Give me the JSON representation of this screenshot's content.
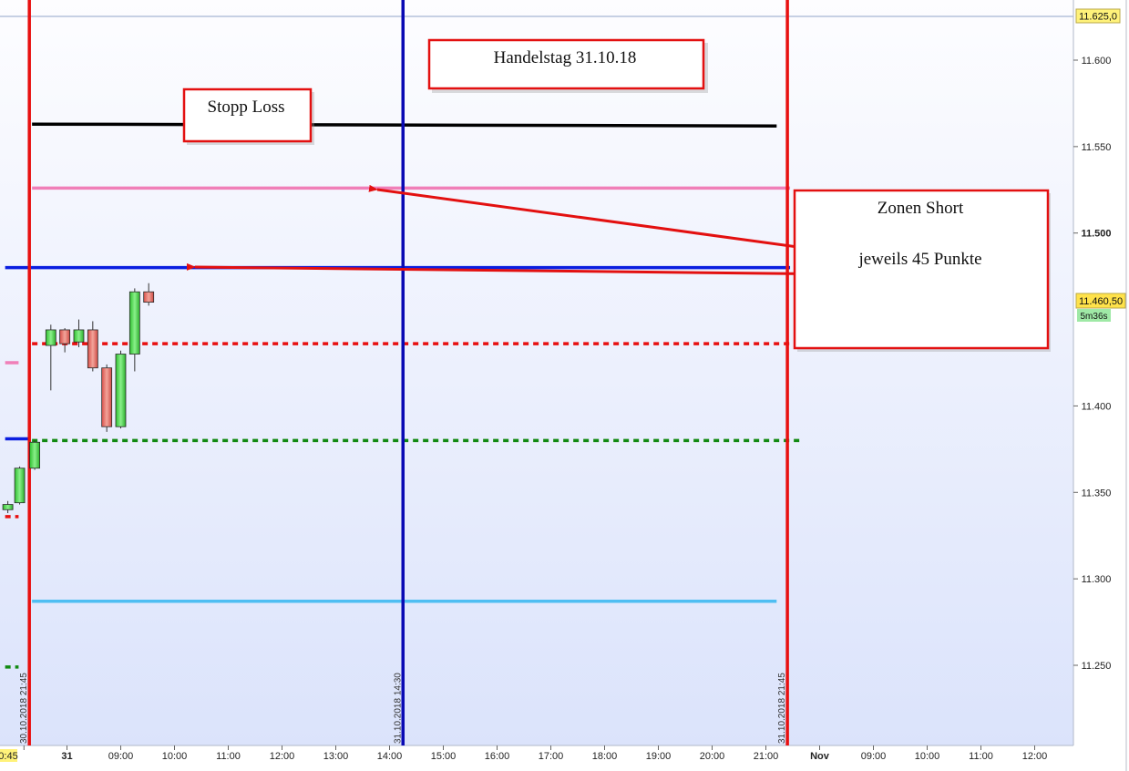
{
  "chart_data": {
    "type": "candlestick",
    "y_axis": {
      "ticks": [
        "11.600",
        "11.550",
        "11.500",
        "11.400",
        "11.350",
        "11.300",
        "11.250"
      ],
      "tick_values": [
        11600,
        11550,
        11500,
        11400,
        11350,
        11300,
        11250
      ],
      "ylim": [
        11204,
        11625
      ],
      "top_label": "11.625,0",
      "last_price_label": "11.460,50",
      "timer_label": "5m36s",
      "last_price": 11460.5
    },
    "x_axis": {
      "ticks": [
        {
          "label": "0:45",
          "t": -0.3
        },
        {
          "label": "31",
          "t": 0.5
        },
        {
          "label": "09:00",
          "t": 1.5
        },
        {
          "label": "10:00",
          "t": 2.5
        },
        {
          "label": "11:00",
          "t": 3.5
        },
        {
          "label": "12:00",
          "t": 4.5
        },
        {
          "label": "13:00",
          "t": 5.5
        },
        {
          "label": "14:00",
          "t": 6.5
        },
        {
          "label": "15:00",
          "t": 7.5
        },
        {
          "label": "16:00",
          "t": 8.5
        },
        {
          "label": "17:00",
          "t": 9.5
        },
        {
          "label": "18:00",
          "t": 10.5
        },
        {
          "label": "19:00",
          "t": 11.5
        },
        {
          "label": "20:00",
          "t": 12.5
        },
        {
          "label": "21:00",
          "t": 13.5
        },
        {
          "label": "Nov",
          "t": 14.5
        },
        {
          "label": "09:00",
          "t": 15.5
        },
        {
          "label": "10:00",
          "t": 16.5
        },
        {
          "label": "11:00",
          "t": 17.5
        },
        {
          "label": "12:00",
          "t": 18.5
        }
      ],
      "tlim": [
        -0.65,
        19.4
      ]
    },
    "vertical_lines": [
      {
        "label": "30.10.2018 21:45",
        "t": -0.2,
        "color": "#e81010"
      },
      {
        "label": "31.10.2018 14:30",
        "t": 6.75,
        "color": "#0a0ab4"
      },
      {
        "label": "31.10.2018 21:45",
        "t": 13.9,
        "color": "#e81010"
      }
    ],
    "horizontal_levels": [
      {
        "y": 11563,
        "t0": -0.15,
        "t1": 13.7,
        "color": "#000000",
        "style": "solid"
      },
      {
        "y": 11526,
        "t0": -0.15,
        "t1": 13.95,
        "color": "#f07fb8",
        "style": "solid"
      },
      {
        "y": 11480,
        "t0": -0.65,
        "t1": 13.95,
        "color": "#0a1ee0",
        "style": "solid"
      },
      {
        "y": 11436,
        "t0": -0.15,
        "t1": 13.95,
        "color": "#e81010",
        "style": "dashed"
      },
      {
        "y": 11380,
        "t0": -0.15,
        "t1": 14.2,
        "color": "#128a12",
        "style": "dashed"
      },
      {
        "y": 11287,
        "t0": -0.15,
        "t1": 13.7,
        "color": "#4fbef2",
        "style": "solid"
      },
      {
        "y": 11425,
        "t0": -0.65,
        "t1": -0.4,
        "color": "#f07fb8",
        "style": "solid"
      },
      {
        "y": 11381,
        "t0": -0.65,
        "t1": -0.2,
        "color": "#0a1ee0",
        "style": "solid"
      },
      {
        "y": 11336,
        "t0": -0.65,
        "t1": -0.4,
        "color": "#e81010",
        "style": "dashed"
      },
      {
        "y": 11249,
        "t0": -0.65,
        "t1": -0.4,
        "color": "#128a12",
        "style": "dashed"
      }
    ],
    "candles": [
      {
        "t": -0.6,
        "o": 11340,
        "h": 11345,
        "l": 11338,
        "c": 11343
      },
      {
        "t": -0.38,
        "o": 11344,
        "h": 11365,
        "l": 11343,
        "c": 11364
      },
      {
        "t": -0.1,
        "o": 11364,
        "h": 11380,
        "l": 11363,
        "c": 11379
      },
      {
        "t": 0.2,
        "o": 11435,
        "h": 11447,
        "l": 11409,
        "c": 11444
      },
      {
        "t": 0.46,
        "o": 11444,
        "h": 11445,
        "l": 11431,
        "c": 11436
      },
      {
        "t": 0.72,
        "o": 11437,
        "h": 11450,
        "l": 11434,
        "c": 11444
      },
      {
        "t": 0.98,
        "o": 11444,
        "h": 11449,
        "l": 11420,
        "c": 11422
      },
      {
        "t": 1.24,
        "o": 11422,
        "h": 11424,
        "l": 11385,
        "c": 11388
      },
      {
        "t": 1.5,
        "o": 11388,
        "h": 11432,
        "l": 11387,
        "c": 11430
      },
      {
        "t": 1.76,
        "o": 11430,
        "h": 11468,
        "l": 11420,
        "c": 11466
      },
      {
        "t": 2.02,
        "o": 11466,
        "h": 11471,
        "l": 11458,
        "c": 11460
      }
    ],
    "annotations": [
      {
        "text": "Handelstag 31.10.18"
      },
      {
        "text": "Stopp Loss"
      },
      {
        "text": "Zonen Short",
        "text2": "jeweils 45 Punkte"
      }
    ]
  }
}
